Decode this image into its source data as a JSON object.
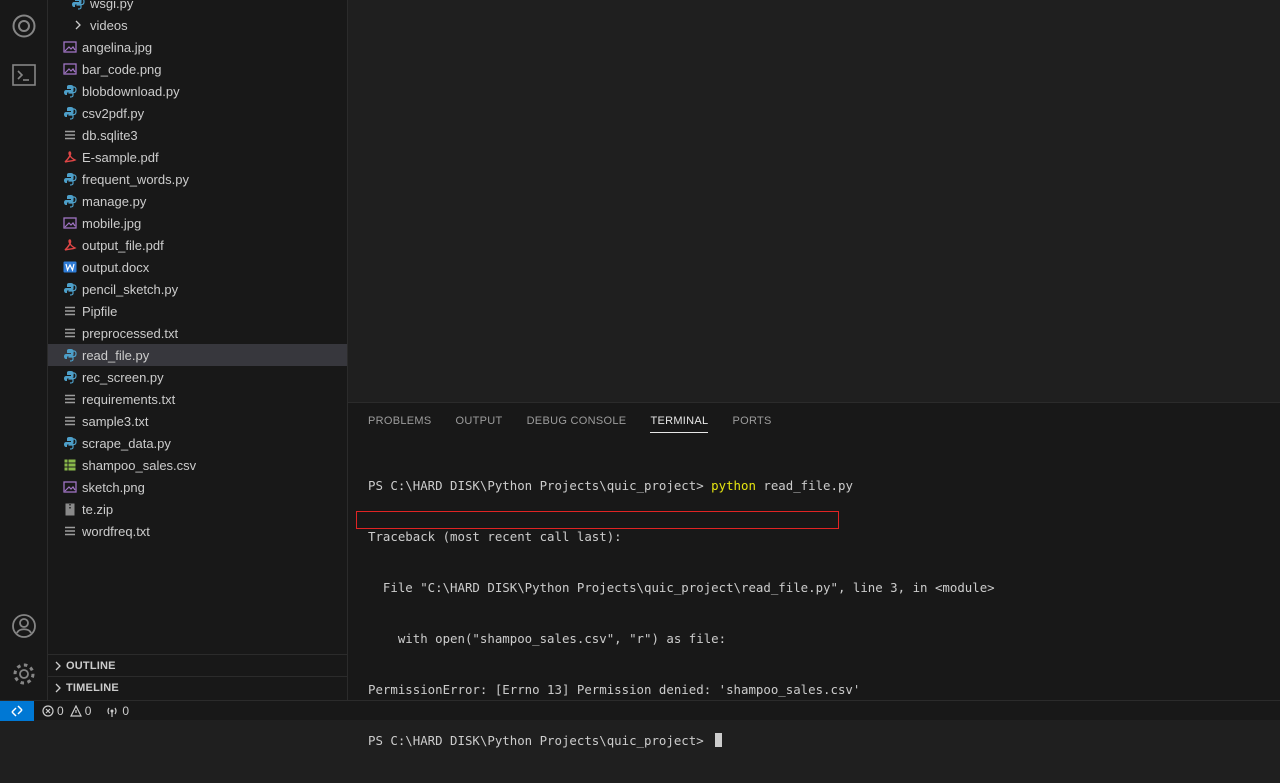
{
  "explorer": {
    "files": [
      {
        "name": "wsgi.py",
        "type": "py",
        "indent": 1
      },
      {
        "name": "videos",
        "type": "folder",
        "indent": 1
      },
      {
        "name": "angelina.jpg",
        "type": "img"
      },
      {
        "name": "bar_code.png",
        "type": "img"
      },
      {
        "name": "blobdownload.py",
        "type": "py"
      },
      {
        "name": "csv2pdf.py",
        "type": "py"
      },
      {
        "name": "db.sqlite3",
        "type": "txt"
      },
      {
        "name": "E-sample.pdf",
        "type": "pdf"
      },
      {
        "name": "frequent_words.py",
        "type": "py"
      },
      {
        "name": "manage.py",
        "type": "py"
      },
      {
        "name": "mobile.jpg",
        "type": "img"
      },
      {
        "name": "output_file.pdf",
        "type": "pdf"
      },
      {
        "name": "output.docx",
        "type": "docx"
      },
      {
        "name": "pencil_sketch.py",
        "type": "py"
      },
      {
        "name": "Pipfile",
        "type": "txt"
      },
      {
        "name": "preprocessed.txt",
        "type": "txt"
      },
      {
        "name": "read_file.py",
        "type": "py",
        "selected": true
      },
      {
        "name": "rec_screen.py",
        "type": "py"
      },
      {
        "name": "requirements.txt",
        "type": "txt"
      },
      {
        "name": "sample3.txt",
        "type": "txt"
      },
      {
        "name": "scrape_data.py",
        "type": "py"
      },
      {
        "name": "shampoo_sales.csv",
        "type": "csv"
      },
      {
        "name": "sketch.png",
        "type": "img"
      },
      {
        "name": "te.zip",
        "type": "zip"
      },
      {
        "name": "wordfreq.txt",
        "type": "txt"
      }
    ],
    "outline_label": "OUTLINE",
    "timeline_label": "TIMELINE"
  },
  "panel": {
    "tabs": [
      "PROBLEMS",
      "OUTPUT",
      "DEBUG CONSOLE",
      "TERMINAL",
      "PORTS"
    ],
    "active_tab": "TERMINAL",
    "terminal": {
      "prompt": "PS C:\\HARD DISK\\Python Projects\\quic_project> ",
      "command_keyword": "python",
      "command_args": " read_file.py",
      "line2": "Traceback (most recent call last):",
      "line3": "  File \"C:\\HARD DISK\\Python Projects\\quic_project\\read_file.py\", line 3, in <module>",
      "line4": "    with open(\"shampoo_sales.csv\", \"r\") as file:",
      "line5": "PermissionError: [Errno 13] Permission denied: 'shampoo_sales.csv'",
      "line6": "PS C:\\HARD DISK\\Python Projects\\quic_project> "
    }
  },
  "statusbar": {
    "errors": "0",
    "warnings": "0",
    "ports": "0"
  },
  "colors": {
    "accent": "#0078d4",
    "python_icon": "#4d9fc9",
    "image_icon": "#a074c4",
    "pdf_icon": "#e04646",
    "docx_icon": "#2e7bd6",
    "csv_icon": "#89b94a",
    "error_box": "#e02424"
  }
}
